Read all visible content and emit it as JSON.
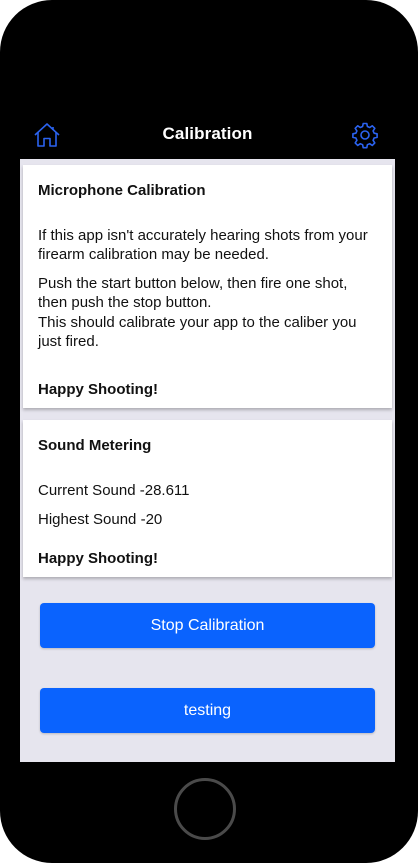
{
  "colors": {
    "accent": "#0a63fe",
    "nav_background": "#000000",
    "screen_background": "#e6e5ee"
  },
  "nav": {
    "title": "Calibration",
    "left_icon": "home-icon",
    "right_icon": "gear-icon"
  },
  "microphone_card": {
    "title": "Microphone Calibration",
    "paragraph1": "If this app isn't accurately hearing shots from your firearm calibration may be needed.",
    "paragraph2_line1": "Push the start button below, then fire one shot, then push the stop button.",
    "paragraph2_line2": "This should calibrate your app to the caliber you just fired.",
    "footer": "Happy Shooting!"
  },
  "sound_card": {
    "title": "Sound Metering",
    "current_sound": "Current Sound -28.611",
    "highest_sound": "Highest Sound -20",
    "footer": "Happy Shooting!"
  },
  "buttons": {
    "stop_label": "Stop Calibration",
    "testing_label": "testing"
  }
}
